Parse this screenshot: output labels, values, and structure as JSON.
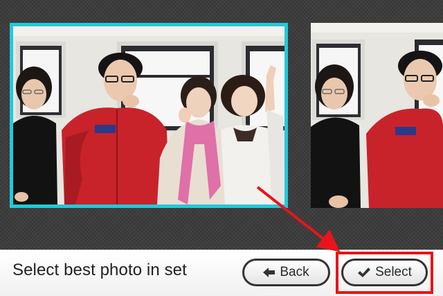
{
  "prompt": {
    "text": "Select best photo in set"
  },
  "buttons": {
    "back_label": "Back",
    "back_icon": "arrow-left-icon",
    "select_label": "Select",
    "select_icon": "checkmark-icon"
  },
  "photos": [
    {
      "state": "selected",
      "border_color": "#22c8dc"
    },
    {
      "state": "next"
    }
  ],
  "annotation": {
    "color": "#e8141a",
    "highlight": "select-button",
    "arrow_from": "selected-photo"
  }
}
